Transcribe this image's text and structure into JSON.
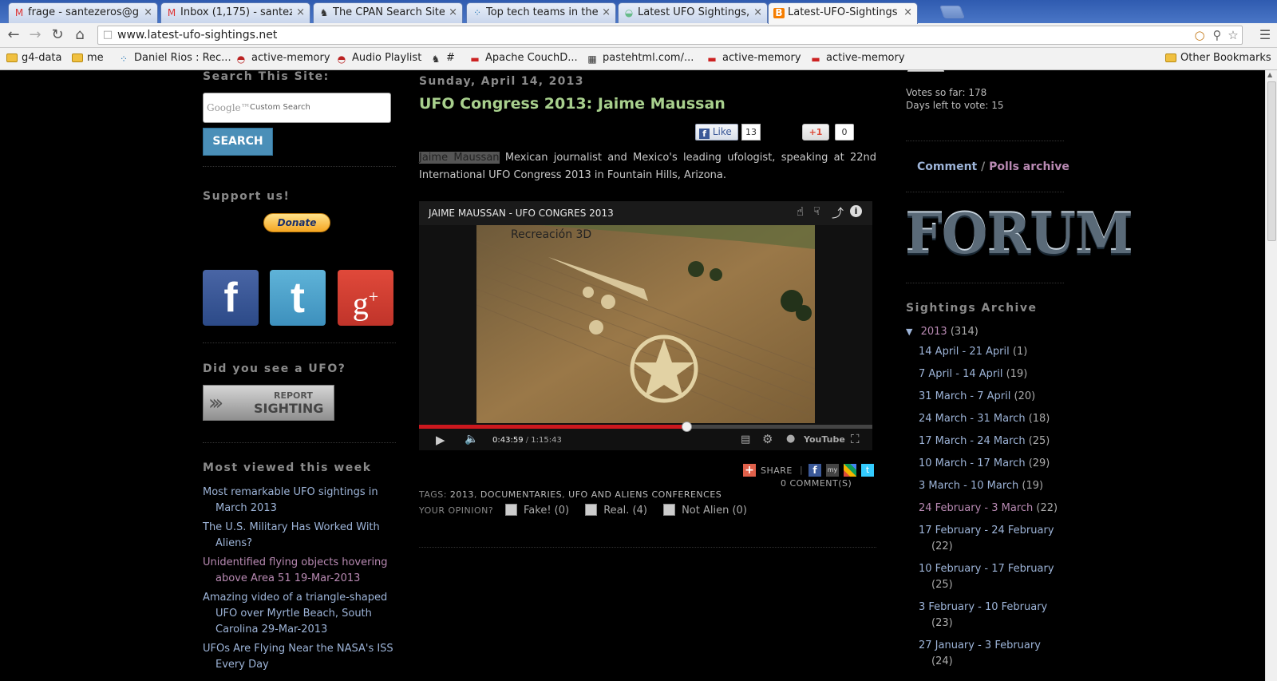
{
  "browser": {
    "tabs": [
      {
        "label": "frage - santezeros@gr",
        "icon": "gmail-icon"
      },
      {
        "label": "Inbox (1,175) - santez",
        "icon": "gmail-icon"
      },
      {
        "label": "The CPAN Search Site",
        "icon": "camel-icon"
      },
      {
        "label": "Top tech teams in the",
        "icon": "dots-icon"
      },
      {
        "label": "Latest UFO Sightings, ",
        "icon": "ufo-icon"
      },
      {
        "label": "Latest-UFO-Sightings",
        "icon": "blogger-icon",
        "active": true
      }
    ],
    "close_glyph": "×",
    "url": "www.latest-ufo-sightings.net",
    "bookmarks": [
      {
        "label": "g4-data",
        "icon": "folder-icon"
      },
      {
        "label": "me",
        "icon": "folder-icon"
      },
      {
        "label": "Daniel Rios : Rec...",
        "icon": "dots-icon"
      },
      {
        "label": "active-memory",
        "icon": "helmet-icon"
      },
      {
        "label": "Audio Playlist",
        "icon": "helmet-icon"
      },
      {
        "label": "#",
        "icon": "camel-icon"
      },
      {
        "label": "Apache CouchD...",
        "icon": "couch-icon"
      },
      {
        "label": "pastehtml.com/...",
        "icon": "paste-icon"
      },
      {
        "label": "active-memory",
        "icon": "couch-icon"
      },
      {
        "label": "active-memory",
        "icon": "couch-icon"
      }
    ],
    "other_bookmarks": "Other Bookmarks"
  },
  "left": {
    "search_heading": "Search This Site:",
    "search_placeholder_brand": "Google™",
    "search_placeholder": "Custom Search",
    "search_button": "SEARCH",
    "support_heading": "Support us!",
    "donate_label": "Donate",
    "ufo_heading": "Did you see a UFO?",
    "report_top": "REPORT",
    "report_bottom": "SIGHTING",
    "most_viewed_heading": "Most viewed this week",
    "most_viewed": [
      {
        "line1": "Most remarkable UFO sightings in",
        "line2": "March 2013",
        "visited": false
      },
      {
        "line1": "The U.S. Military Has Worked With",
        "line2": "Aliens?",
        "visited": false
      },
      {
        "line1": "Unidentified flying objects hovering",
        "line2": "above Area 51 19-Mar-2013",
        "visited": true
      },
      {
        "line1": "Amazing video of a triangle-shaped",
        "line2": "UFO over Myrtle Beach, South",
        "line3": "Carolina 29-Mar-2013",
        "visited": false
      },
      {
        "line1": "UFOs Are Flying Near the NASA's ISS",
        "line2": "Every Day",
        "visited": false
      }
    ]
  },
  "post": {
    "date": "Sunday, April 14, 2013",
    "title": "UFO Congress 2013: Jaime Maussan",
    "fb_like": "Like",
    "fb_count": "13",
    "gplus": "+1",
    "gplus_count": "0",
    "highlight": "Jaime Maussan",
    "body_rest": " Mexican journalist and Mexico's leading ufologist, speaking at 22nd International UFO Congress 2013 in Fountain Hills, Arizona.",
    "video": {
      "title": "JAIME MAUSSAN - UFO CONGRES 2013",
      "overlay": "Recreación 3D",
      "time_current": "0:43:59",
      "time_sep": " / ",
      "time_total": "1:15:43",
      "progress": 0.59,
      "youtube": "YouTube"
    },
    "share_label": "SHARE",
    "comments": "0 COMMENT(S)",
    "tags_label": "TAGS:",
    "tags": [
      "2013",
      "DOCUMENTARIES",
      "UFO AND ALIENS CONFERENCES"
    ],
    "opinion_label": "YOUR OPINION?",
    "opinions": [
      "Fake! (0)",
      "Real. (4)",
      "Not Alien (0)"
    ]
  },
  "right": {
    "votes": "Votes so far: 178",
    "days": "Days left to vote: 15",
    "comment_link": "Comment",
    "poll_sep": " / ",
    "polls_link": "Polls archive",
    "forum_logo": "FORUM",
    "archive_heading": "Sightings Archive",
    "year_toggle": "▼",
    "year": "2013",
    "year_count": " (314)",
    "weeks": [
      {
        "label": "14 April - 21 April",
        "count": "(1)",
        "visited": false
      },
      {
        "label": "7 April - 14 April",
        "count": "(19)",
        "visited": false
      },
      {
        "label": "31 March - 7 April",
        "count": "(20)",
        "visited": false
      },
      {
        "label": "24 March - 31 March",
        "count": "(18)",
        "visited": false
      },
      {
        "label": "17 March - 24 March",
        "count": "(25)",
        "visited": false
      },
      {
        "label": "10 March - 17 March",
        "count": "(29)",
        "visited": false
      },
      {
        "label": "3 March - 10 March",
        "count": "(19)",
        "visited": false
      },
      {
        "label": "24 February - 3 March",
        "count": "(22)",
        "visited": true
      },
      {
        "label": "17 February - 24 February",
        "count": "(22)",
        "visited": false,
        "wrap": true
      },
      {
        "label": "10 February - 17 February",
        "count": "(25)",
        "visited": false,
        "wrap": true
      },
      {
        "label": "3 February - 10 February",
        "count": "(23)",
        "visited": false,
        "wrap": true
      },
      {
        "label": "27 January - 3 February",
        "count": "(24)",
        "visited": false,
        "wrap": true
      }
    ]
  },
  "colors": {
    "title_green": "#a8d08d",
    "link_blue": "#9db4d8",
    "visited_purple": "#b98ab3",
    "heading_gray": "#8a8a8a",
    "progress_red": "#cc181e"
  }
}
